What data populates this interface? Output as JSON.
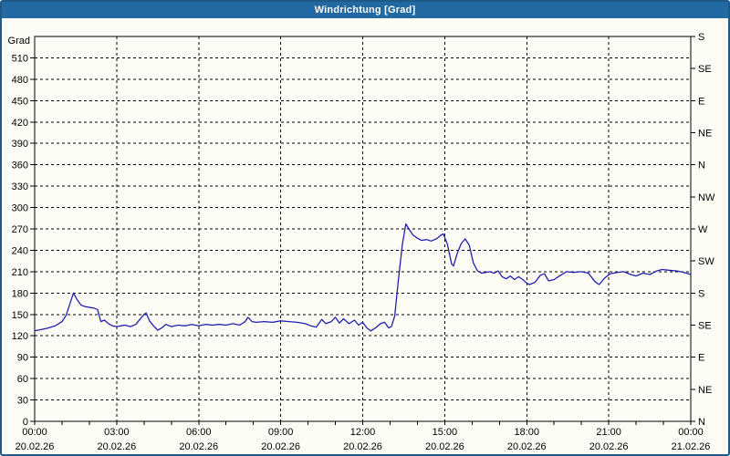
{
  "window": {
    "title": "Windrichtung [Grad]"
  },
  "colors": {
    "titlebar_bg": "#2269a1",
    "titlebar_text": "#ffffff",
    "window_border": "#1d5a88",
    "background": "#fdfdf6",
    "line": "#2020b0",
    "grid": "#000000",
    "axis": "#000000",
    "text": "#000000"
  },
  "chart_data": {
    "type": "line",
    "title": "Windrichtung [Grad]",
    "ylabel_left": "Grad",
    "ylim": [
      0,
      540
    ],
    "xlim_hours": [
      0,
      24
    ],
    "grid": "dashed",
    "legend": "none",
    "y_left_ticks": [
      0,
      30,
      60,
      90,
      120,
      150,
      180,
      210,
      240,
      270,
      300,
      330,
      360,
      390,
      420,
      450,
      480,
      510
    ],
    "y_right_ticks": [
      {
        "deg": 540,
        "label": "S"
      },
      {
        "deg": 495,
        "label": "SE"
      },
      {
        "deg": 450,
        "label": "E"
      },
      {
        "deg": 405,
        "label": "NE"
      },
      {
        "deg": 360,
        "label": "N"
      },
      {
        "deg": 315,
        "label": "NW"
      },
      {
        "deg": 270,
        "label": "W"
      },
      {
        "deg": 225,
        "label": "SW"
      },
      {
        "deg": 180,
        "label": "S"
      },
      {
        "deg": 135,
        "label": "SE"
      },
      {
        "deg": 90,
        "label": "E"
      },
      {
        "deg": 45,
        "label": "NE"
      },
      {
        "deg": 0,
        "label": "N"
      }
    ],
    "x_major_ticks": [
      {
        "hour": 0,
        "time": "00:00",
        "date": "20.02.26"
      },
      {
        "hour": 3,
        "time": "03:00",
        "date": "20.02.26"
      },
      {
        "hour": 6,
        "time": "06:00",
        "date": "20.02.26"
      },
      {
        "hour": 9,
        "time": "09:00",
        "date": "20.02.26"
      },
      {
        "hour": 12,
        "time": "12:00",
        "date": "20.02.26"
      },
      {
        "hour": 15,
        "time": "15:00",
        "date": "20.02.26"
      },
      {
        "hour": 18,
        "time": "18:00",
        "date": "20.02.26"
      },
      {
        "hour": 21,
        "time": "21:00",
        "date": "20.02.26"
      },
      {
        "hour": 24,
        "time": "00:00",
        "date": "21.02.26"
      }
    ],
    "x_minor_step_hours": 1,
    "series": [
      {
        "name": "Windrichtung",
        "unit": "Grad",
        "points": [
          [
            0,
            127
          ],
          [
            0.25,
            129
          ],
          [
            0.5,
            131
          ],
          [
            0.75,
            134
          ],
          [
            1.0,
            140
          ],
          [
            1.15,
            149
          ],
          [
            1.3,
            166
          ],
          [
            1.42,
            180
          ],
          [
            1.55,
            171
          ],
          [
            1.7,
            163
          ],
          [
            1.85,
            161
          ],
          [
            2.0,
            160
          ],
          [
            2.15,
            159
          ],
          [
            2.3,
            157
          ],
          [
            2.42,
            140
          ],
          [
            2.55,
            142
          ],
          [
            2.7,
            137
          ],
          [
            2.85,
            134
          ],
          [
            3.0,
            133
          ],
          [
            3.15,
            134
          ],
          [
            3.3,
            135
          ],
          [
            3.5,
            133
          ],
          [
            3.7,
            136
          ],
          [
            3.85,
            143
          ],
          [
            4.0,
            150
          ],
          [
            4.08,
            152
          ],
          [
            4.2,
            141
          ],
          [
            4.35,
            134
          ],
          [
            4.5,
            128
          ],
          [
            4.65,
            131
          ],
          [
            4.8,
            136
          ],
          [
            5.0,
            133
          ],
          [
            5.25,
            135
          ],
          [
            5.5,
            134
          ],
          [
            5.75,
            136
          ],
          [
            6.0,
            134
          ],
          [
            6.25,
            136
          ],
          [
            6.5,
            135
          ],
          [
            6.75,
            136
          ],
          [
            7.0,
            135
          ],
          [
            7.25,
            137
          ],
          [
            7.5,
            135
          ],
          [
            7.7,
            140
          ],
          [
            7.8,
            146
          ],
          [
            7.95,
            140
          ],
          [
            8.1,
            139
          ],
          [
            8.4,
            140
          ],
          [
            8.7,
            139
          ],
          [
            9.0,
            141
          ],
          [
            9.3,
            140
          ],
          [
            9.6,
            139
          ],
          [
            9.9,
            137
          ],
          [
            10.1,
            134
          ],
          [
            10.3,
            132
          ],
          [
            10.5,
            143
          ],
          [
            10.65,
            137
          ],
          [
            10.85,
            140
          ],
          [
            11.0,
            146
          ],
          [
            11.15,
            138
          ],
          [
            11.3,
            144
          ],
          [
            11.5,
            137
          ],
          [
            11.7,
            142
          ],
          [
            11.85,
            135
          ],
          [
            12.0,
            139
          ],
          [
            12.15,
            131
          ],
          [
            12.3,
            127
          ],
          [
            12.5,
            132
          ],
          [
            12.65,
            137
          ],
          [
            12.8,
            139
          ],
          [
            12.95,
            131
          ],
          [
            13.05,
            133
          ],
          [
            13.17,
            148
          ],
          [
            13.3,
            196
          ],
          [
            13.45,
            248
          ],
          [
            13.58,
            277
          ],
          [
            13.72,
            268
          ],
          [
            13.85,
            261
          ],
          [
            14.0,
            257
          ],
          [
            14.15,
            254
          ],
          [
            14.35,
            255
          ],
          [
            14.5,
            253
          ],
          [
            14.7,
            256
          ],
          [
            14.85,
            261
          ],
          [
            14.95,
            263
          ],
          [
            15.1,
            248
          ],
          [
            15.25,
            221
          ],
          [
            15.32,
            218
          ],
          [
            15.45,
            235
          ],
          [
            15.6,
            249
          ],
          [
            15.75,
            256
          ],
          [
            15.9,
            247
          ],
          [
            16.05,
            222
          ],
          [
            16.2,
            211
          ],
          [
            16.35,
            208
          ],
          [
            16.5,
            209
          ],
          [
            16.65,
            210
          ],
          [
            16.8,
            208
          ],
          [
            16.95,
            211
          ],
          [
            17.1,
            203
          ],
          [
            17.25,
            200
          ],
          [
            17.4,
            204
          ],
          [
            17.55,
            199
          ],
          [
            17.7,
            203
          ],
          [
            17.85,
            199
          ],
          [
            18.0,
            194
          ],
          [
            18.1,
            192
          ],
          [
            18.3,
            195
          ],
          [
            18.5,
            205
          ],
          [
            18.65,
            207
          ],
          [
            18.8,
            197
          ],
          [
            19.0,
            199
          ],
          [
            19.2,
            204
          ],
          [
            19.45,
            210
          ],
          [
            19.7,
            209
          ],
          [
            20.0,
            210
          ],
          [
            20.25,
            208
          ],
          [
            20.5,
            196
          ],
          [
            20.65,
            192
          ],
          [
            20.85,
            201
          ],
          [
            21.05,
            207
          ],
          [
            21.3,
            209
          ],
          [
            21.55,
            210
          ],
          [
            21.8,
            206
          ],
          [
            22.0,
            204
          ],
          [
            22.25,
            208
          ],
          [
            22.5,
            206
          ],
          [
            22.75,
            211
          ],
          [
            22.95,
            213
          ],
          [
            23.2,
            212
          ],
          [
            23.5,
            211
          ],
          [
            23.75,
            209
          ],
          [
            24.0,
            206
          ]
        ]
      }
    ]
  }
}
